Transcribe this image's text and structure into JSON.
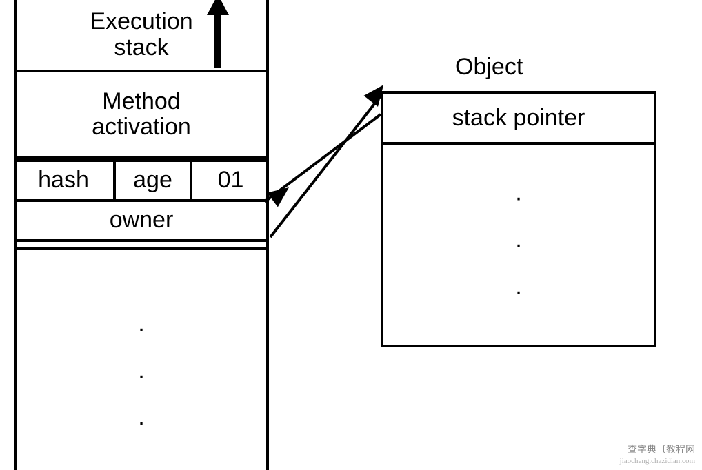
{
  "stack": {
    "title": "Execution\nstack",
    "method": "Method\nactivation",
    "markword": {
      "hash": "hash",
      "age": "age",
      "bits": "01"
    },
    "owner": "owner",
    "rest_dots": "·\n·\n·"
  },
  "object": {
    "title": "Object",
    "header": "stack pointer",
    "body_dots": "·\n·\n·"
  },
  "watermark": {
    "cn": "查字典〔教程网",
    "en": "jiaocheng.chazidian.com"
  }
}
